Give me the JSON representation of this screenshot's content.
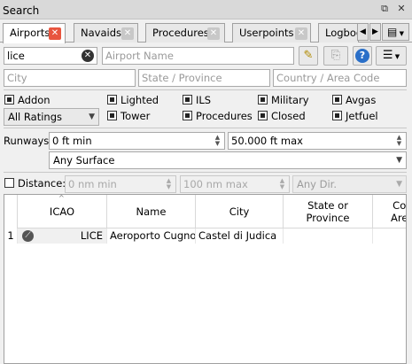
{
  "window": {
    "title": "Search",
    "float_icon": "float-window-icon",
    "close_icon": "close-icon"
  },
  "tabs": [
    {
      "label": "Airports",
      "active": true
    },
    {
      "label": "Navaids",
      "active": false
    },
    {
      "label": "Procedures",
      "active": false
    },
    {
      "label": "Userpoints",
      "active": false
    },
    {
      "label": "Logboo",
      "active": false
    }
  ],
  "tab_scroll": {
    "left": "tab-scroll-left-icon",
    "right": "tab-scroll-right-icon",
    "menu": "tab-menu-icon"
  },
  "search": {
    "ident_value": "lice",
    "name_placeholder": "Airport Name",
    "city_placeholder": "City",
    "state_placeholder": "State / Province",
    "country_placeholder": "Country / Area Code"
  },
  "filters": {
    "addon": "Addon",
    "lighted": "Lighted",
    "ils": "ILS",
    "military": "Military",
    "avgas": "Avgas",
    "ratings": "All Ratings",
    "tower": "Tower",
    "procedures": "Procedures",
    "closed": "Closed",
    "jetfuel": "Jetfuel"
  },
  "runways": {
    "label": "Runways:",
    "min": "0 ft min",
    "max": "50.000 ft max",
    "surface": "Any Surface"
  },
  "distance": {
    "label": "Distance:",
    "min": "0 nm min",
    "max": "100 nm max",
    "direction": "Any Dir."
  },
  "table": {
    "columns": [
      "ICAO",
      "Name",
      "City",
      "State or\nProvince",
      "Co\nAre"
    ],
    "rows": [
      {
        "index": "1",
        "icao": "LICE",
        "name": "Aeroporto Cugno",
        "city": "Castel di Judica",
        "state": "",
        "country": ""
      }
    ]
  }
}
